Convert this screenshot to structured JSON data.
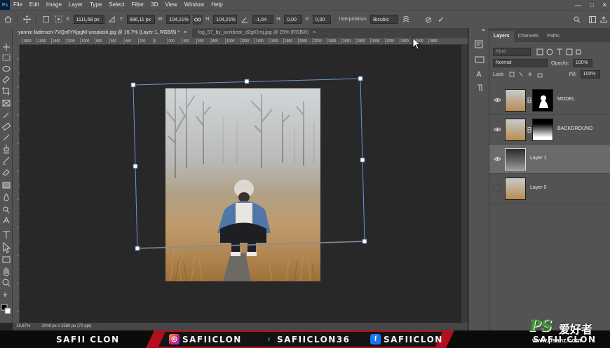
{
  "app": {
    "logo": "Ps"
  },
  "menubar": {
    "items": [
      "File",
      "Edit",
      "Image",
      "Layer",
      "Type",
      "Select",
      "Filter",
      "3D",
      "View",
      "Window",
      "Help"
    ],
    "window_controls": [
      "—",
      "□",
      "✕"
    ]
  },
  "options": {
    "x_label": "X:",
    "x_value": "1111,68 px",
    "y_label": "Y:",
    "y_value": "996,11 px",
    "w_label": "W:",
    "w_value": "104,21%",
    "h_label": "H:",
    "h_value": "104,21%",
    "angle_value": "-1,64",
    "hskew_label": "H:",
    "hskew_value": "0,00",
    "vskew_label": "V:",
    "vskew_value": "0,00",
    "interp_label": "Interpolation:",
    "interp_value": "Bicubic",
    "cancel_glyph": "⊘",
    "commit_glyph": "✓"
  },
  "tabs": [
    {
      "label": "yannic-laderach-7VQo6YKjpgM-unsplash.jpg @ 16,7% (Layer 1, RGB/8) *",
      "close": "×"
    },
    {
      "label": "fog_57_by_lumibear_d2g61mj.jpg @ 25% (RGB/8)",
      "close": "×"
    }
  ],
  "ruler": {
    "ticks": [
      "1800",
      "1600",
      "1400",
      "1200",
      "1000",
      "800",
      "600",
      "400",
      "200",
      "0",
      "200",
      "400",
      "600",
      "800",
      "1000",
      "1200",
      "1400",
      "1600",
      "1800",
      "2000",
      "2200",
      "2400",
      "2600",
      "2800",
      "3000",
      "3200",
      "3400",
      "3600",
      "3800"
    ]
  },
  "status": {
    "zoom": "16,67%",
    "doc_size": "2048 px x 2560 px (72 ppi)"
  },
  "layers_panel": {
    "tabs": [
      "Layers",
      "Channels",
      "Paths"
    ],
    "kind_placeholder": "Kind",
    "blend_mode": "Normal",
    "opacity_label": "Opacity:",
    "opacity_value": "100%",
    "lock_label": "Lock:",
    "fill_label": "Fill:",
    "fill_value": "100%",
    "layers": [
      {
        "name": "MODEL",
        "visible": true
      },
      {
        "name": "BACKGROUND",
        "visible": true
      },
      {
        "name": "Layer 1",
        "visible": true,
        "selected": true
      },
      {
        "name": "Layer 0",
        "visible": false
      }
    ]
  },
  "banner": {
    "left_name": "SAFII CLON",
    "instagram": "SAFIICLON",
    "tiktok": "SAFIICLON36",
    "facebook": "SAFIICLON",
    "right_name": "SAFII CLON"
  },
  "watermark": {
    "logo": "PS",
    "cn": "爱好者",
    "site": "www.psahz.com"
  },
  "colors": {
    "accent_blue": "#5b86c9",
    "banner_red": "#b3101d"
  }
}
